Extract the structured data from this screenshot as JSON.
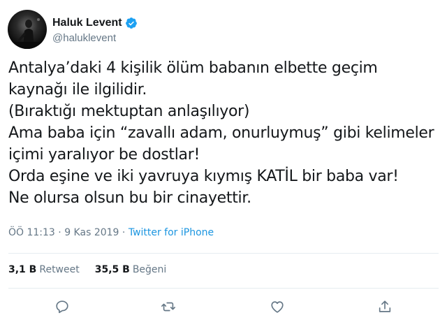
{
  "author": {
    "display_name": "Haluk Levent",
    "handle": "@haluklevent",
    "verified": true,
    "avatar_icon": "avatar"
  },
  "tweet": {
    "lines": [
      "Antalya’daki 4 kişilik ölüm babanın elbette geçim",
      "kaynağı ile ilgilidir.",
      "(Bıraktığı mektuptan anlaşılıyor)",
      "Ama baba için “zavallı adam, onurluymuş” gibi kelimeler",
      "içimi yaralıyor be dostlar!",
      "Orda eşine ve iki yavruya kıymış KATİL bir baba var!",
      "Ne olursa olsun bu bir cinayettir."
    ],
    "time": "ÖÖ 11:13",
    "separator": " · ",
    "date": "9 Kas 2019",
    "source": "Twitter for iPhone"
  },
  "stats": {
    "retweets_count": "3,1 B",
    "retweets_label": "Retweet",
    "likes_count": "35,5 B",
    "likes_label": "Beğeni"
  },
  "actions": [
    "reply-icon",
    "retweet-icon",
    "like-icon",
    "share-icon"
  ],
  "colors": {
    "accent": "#1b95e0",
    "muted": "#657786",
    "text": "#14171a",
    "verified": "#1da1f2"
  }
}
